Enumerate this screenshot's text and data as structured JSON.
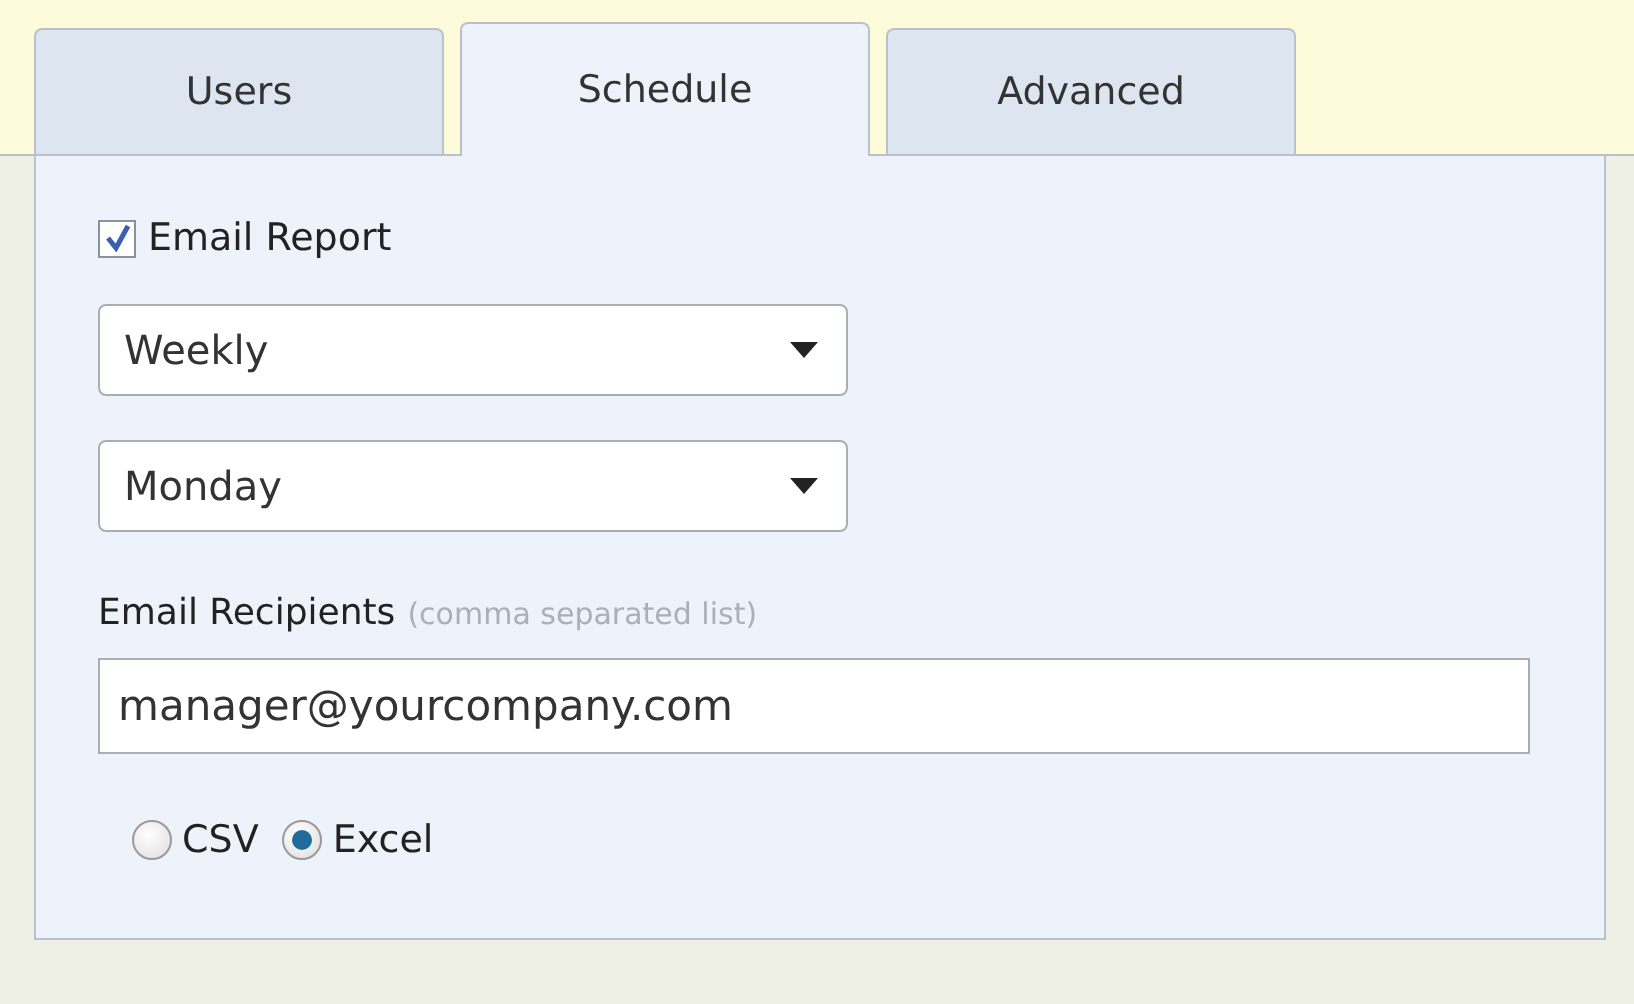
{
  "tabs": [
    {
      "label": "Users",
      "selected": false
    },
    {
      "label": "Schedule",
      "selected": true
    },
    {
      "label": "Advanced",
      "selected": false
    }
  ],
  "email_report": {
    "label": "Email Report",
    "checked": true
  },
  "dropdowns": [
    {
      "value": "Weekly"
    },
    {
      "value": "Monday"
    }
  ],
  "recipients": {
    "label": "Email Recipients",
    "hint": "(comma separated list)",
    "value": "manager@yourcompany.com"
  },
  "formats": [
    {
      "label": "CSV",
      "selected": false
    },
    {
      "label": "Excel",
      "selected": true
    }
  ]
}
